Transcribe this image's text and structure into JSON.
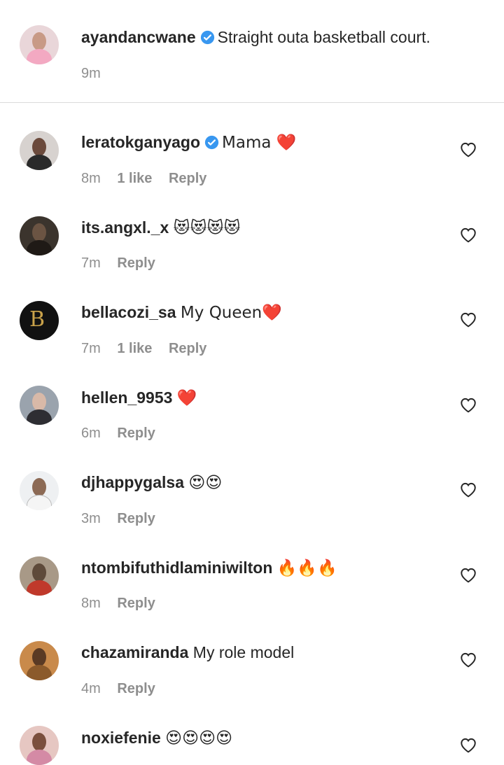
{
  "caption": {
    "username": "ayandancwane",
    "verified": true,
    "text": "Straight outa basketball court.",
    "time": "9m"
  },
  "comments": [
    {
      "username": "leratokganyago",
      "verified": true,
      "text": "Mama ❤️",
      "time": "8m",
      "likes": "1 like",
      "reply": "Reply"
    },
    {
      "username": "its.angxl._x",
      "verified": false,
      "text": "😻😻😻😻",
      "time": "7m",
      "likes": "",
      "reply": "Reply"
    },
    {
      "username": "bellacozi_sa",
      "verified": false,
      "text": "My Queen❤️",
      "time": "7m",
      "likes": "1 like",
      "reply": "Reply"
    },
    {
      "username": "hellen_9953",
      "verified": false,
      "text": "❤️",
      "time": "6m",
      "likes": "",
      "reply": "Reply"
    },
    {
      "username": "djhappygalsa",
      "verified": false,
      "text": "😍😍",
      "time": "3m",
      "likes": "",
      "reply": "Reply"
    },
    {
      "username": "ntombifuthidlaminiwilton",
      "verified": false,
      "text": "🔥🔥🔥",
      "time": "8m",
      "likes": "",
      "reply": "Reply"
    },
    {
      "username": "chazamiranda",
      "verified": false,
      "text": "My role model",
      "time": "4m",
      "likes": "",
      "reply": "Reply"
    },
    {
      "username": "noxiefenie",
      "verified": false,
      "text": "😍😍😍😍",
      "time": "",
      "likes": "",
      "reply": ""
    }
  ],
  "icons": {
    "verified": "verified-badge-icon",
    "like": "heart-outline-icon"
  },
  "colors": {
    "verified": "#3897f0",
    "secondary_text": "#8e8e8e",
    "divider": "#dbdbdb"
  }
}
